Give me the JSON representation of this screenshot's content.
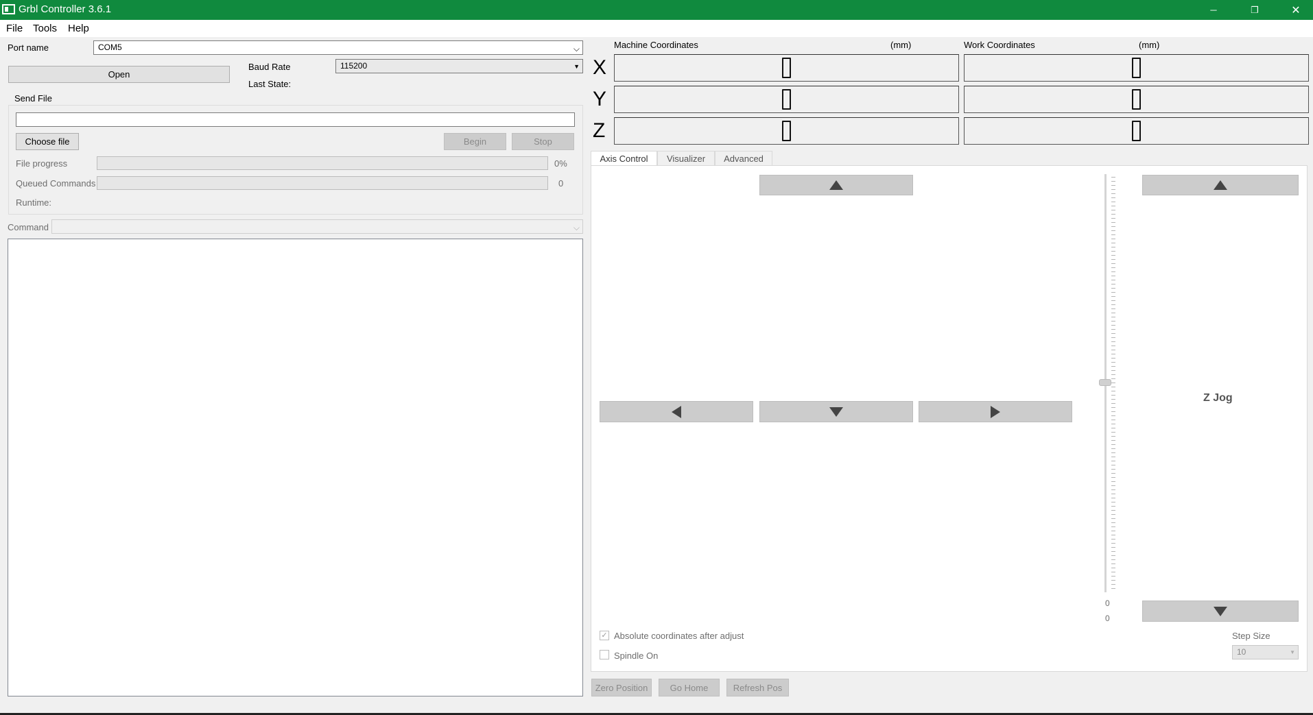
{
  "window": {
    "title": "Grbl Controller 3.6.1",
    "controls": {
      "minimize": "─",
      "restore": "❐",
      "close": "✕"
    },
    "accent_color": "#108a3e"
  },
  "menu": [
    "File",
    "Tools",
    "Help"
  ],
  "connection": {
    "port_label": "Port name",
    "port_value": "COM5",
    "open_button": "Open",
    "baud_label": "Baud Rate",
    "baud_value": "115200",
    "last_state_label": "Last State:"
  },
  "send_file": {
    "group_title": "Send File",
    "file_path": "",
    "choose_button": "Choose file",
    "begin_button": "Begin",
    "stop_button": "Stop",
    "progress_label": "File progress",
    "progress_value": "0%",
    "queued_label": "Queued Commands",
    "queued_value": "0",
    "runtime_label": "Runtime:"
  },
  "command": {
    "label": "Command",
    "value": ""
  },
  "coordinates": {
    "machine_title": "Machine Coordinates",
    "machine_unit": "(mm)",
    "work_title": "Work Coordinates",
    "work_unit": "(mm)",
    "axes": [
      "X",
      "Y",
      "Z"
    ],
    "machine_values": [
      "0",
      "0",
      "0"
    ],
    "work_values": [
      "0",
      "0",
      "0"
    ]
  },
  "tabs": [
    "Axis Control",
    "Visualizer",
    "Advanced"
  ],
  "axis_control": {
    "z_jog_label": "Z Jog",
    "slider_value_top": "0",
    "slider_value_bottom": "0",
    "absolute_coords_label": "Absolute coordinates after adjust",
    "absolute_coords_checked": true,
    "spindle_label": "Spindle On",
    "spindle_checked": false,
    "step_size_label": "Step Size",
    "step_size_value": "10"
  },
  "bottom_buttons": {
    "zero": "Zero Position",
    "home": "Go Home",
    "refresh": "Refresh Pos"
  }
}
